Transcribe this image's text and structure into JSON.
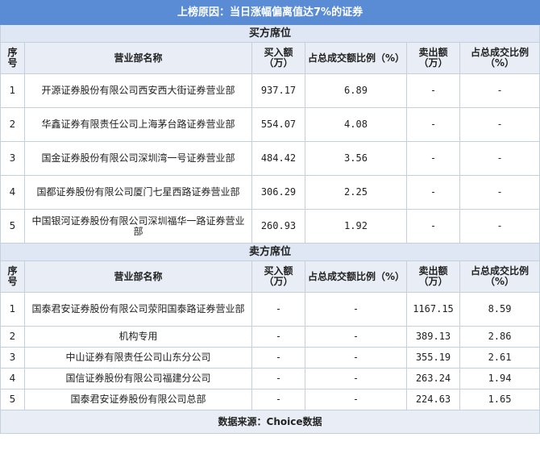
{
  "title": "上榜原因：当日涨幅偏离值达7%的证券",
  "buy_section": {
    "label": "买方席位",
    "headers": [
      "序号",
      "营业部名称",
      "买入额（万）",
      "占总成交额比例（%）",
      "卖出额（万）",
      "占总成交比例（%）"
    ],
    "rows": [
      {
        "no": "1",
        "name": "开源证券股份有限公司西安西大街证券营业部",
        "buy": "937.17",
        "buy_pct": "6.89",
        "sell": "-",
        "sell_pct": "-"
      },
      {
        "no": "2",
        "name": "华鑫证券有限责任公司上海茅台路证券营业部",
        "buy": "554.07",
        "buy_pct": "4.08",
        "sell": "-",
        "sell_pct": "-"
      },
      {
        "no": "3",
        "name": "国金证券股份有限公司深圳湾一号证券营业部",
        "buy": "484.42",
        "buy_pct": "3.56",
        "sell": "-",
        "sell_pct": "-"
      },
      {
        "no": "4",
        "name": "国都证券股份有限公司厦门七星西路证券营业部",
        "buy": "306.29",
        "buy_pct": "2.25",
        "sell": "-",
        "sell_pct": "-"
      },
      {
        "no": "5",
        "name": "中国银河证券股份有限公司深圳福华一路证券营业部",
        "buy": "260.93",
        "buy_pct": "1.92",
        "sell": "-",
        "sell_pct": "-"
      }
    ]
  },
  "sell_section": {
    "label": "卖方席位",
    "headers": [
      "序号",
      "营业部名称",
      "买入额（万）",
      "占总成交额比例（%）",
      "卖出额（万）",
      "占总成交比例（%）"
    ],
    "rows": [
      {
        "no": "1",
        "name": "国泰君安证券股份有限公司荥阳国泰路证券营业部",
        "buy": "-",
        "buy_pct": "-",
        "sell": "1167.15",
        "sell_pct": "8.59"
      },
      {
        "no": "2",
        "name": "机构专用",
        "buy": "-",
        "buy_pct": "-",
        "sell": "389.13",
        "sell_pct": "2.86"
      },
      {
        "no": "3",
        "name": "中山证券有限责任公司山东分公司",
        "buy": "-",
        "buy_pct": "-",
        "sell": "355.19",
        "sell_pct": "2.61"
      },
      {
        "no": "4",
        "name": "国信证券股份有限公司福建分公司",
        "buy": "-",
        "buy_pct": "-",
        "sell": "263.24",
        "sell_pct": "1.94"
      },
      {
        "no": "5",
        "name": "国泰君安证券股份有限公司总部",
        "buy": "-",
        "buy_pct": "-",
        "sell": "224.63",
        "sell_pct": "1.65"
      }
    ]
  },
  "footer": "数据来源：Choice数据"
}
